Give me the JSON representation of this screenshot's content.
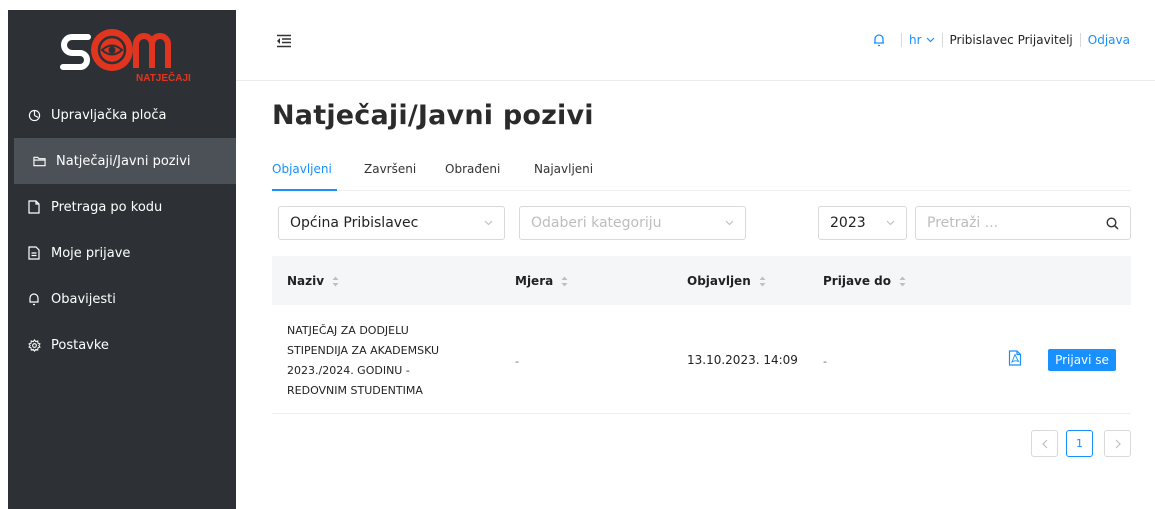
{
  "logo": {
    "text": "NATJEČAJI",
    "brand_color": "#e2351f"
  },
  "sidebar": {
    "items": [
      {
        "label": "Upravljačka ploča",
        "icon": "dashboard-icon"
      },
      {
        "label": "Natječaji/Javni pozivi",
        "icon": "folder-icon",
        "active": true
      },
      {
        "label": "Pretraga po kodu",
        "icon": "file-icon"
      },
      {
        "label": "Moje prijave",
        "icon": "file-text-icon"
      },
      {
        "label": "Obavijesti",
        "icon": "bell-icon"
      },
      {
        "label": "Postavke",
        "icon": "gear-icon"
      }
    ]
  },
  "header": {
    "lang": "hr",
    "user": "Pribislavec Prijavitelj",
    "logout": "Odjava"
  },
  "page": {
    "title": "Natječaji/Javni pozivi"
  },
  "tabs": [
    "Objavljeni",
    "Završeni",
    "Obrađeni",
    "Najavljeni"
  ],
  "filters": {
    "municipality": "Općina Pribislavec",
    "category_placeholder": "Odaberi kategoriju",
    "year": "2023",
    "search_placeholder": "Pretraži ..."
  },
  "table": {
    "columns": [
      "Naziv",
      "Mjera",
      "Objavljen",
      "Prijave do"
    ],
    "rows": [
      {
        "naziv_lines": [
          "NATJEČAJ ZA DODJELU",
          "STIPENDIJA ZA AKADEMSKU",
          "2023./2024. GODINU -",
          "REDOVNIM STUDENTIMA"
        ],
        "mjera": "-",
        "objavljen": "13.10.2023. 14:09",
        "prijave_do": "-",
        "action": "Prijavi se"
      }
    ]
  },
  "pagination": {
    "current": "1"
  },
  "colors": {
    "accent": "#1890ff",
    "sidebar": "#2d3135",
    "sidebar_active": "#4b5157"
  }
}
